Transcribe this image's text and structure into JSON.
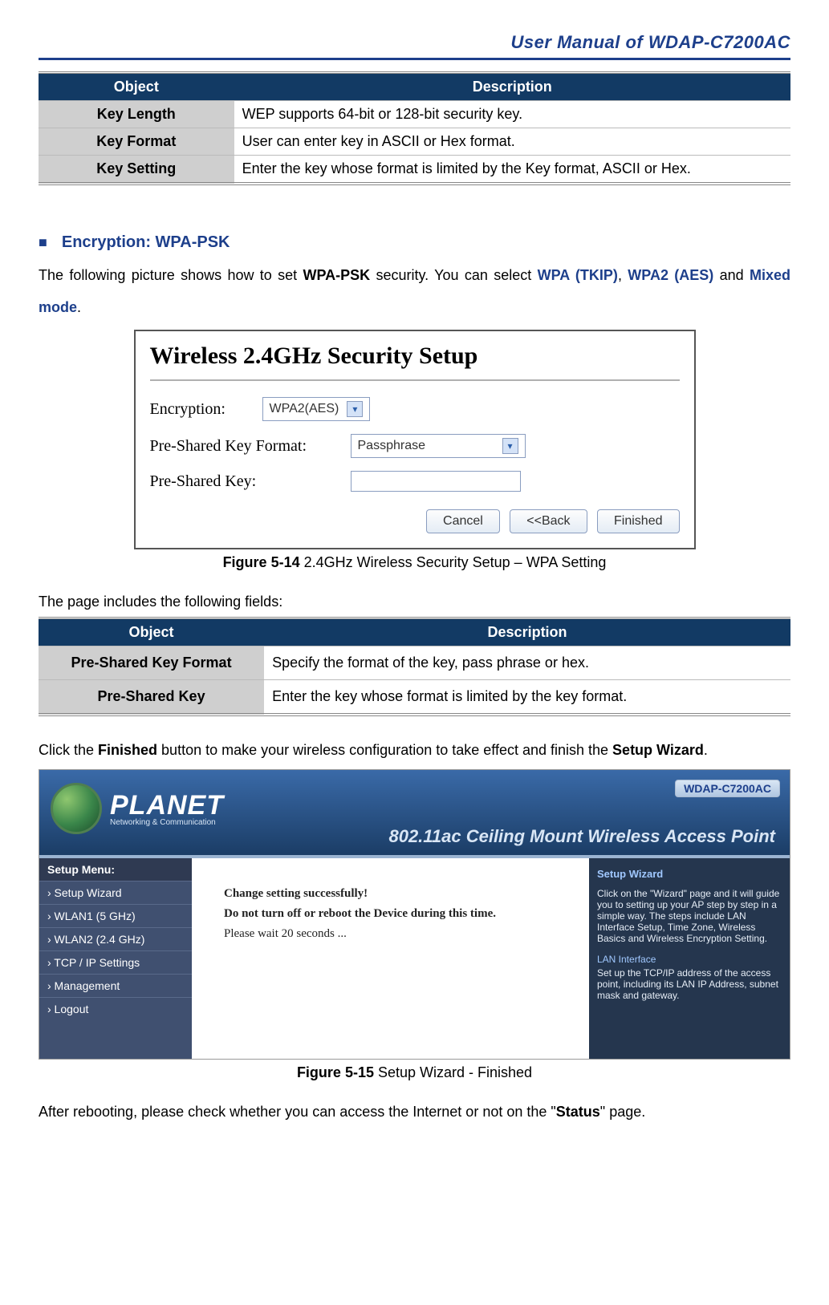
{
  "header": {
    "title": "User Manual of WDAP-C7200AC"
  },
  "table1": {
    "head_object": "Object",
    "head_desc": "Description",
    "rows": [
      {
        "obj": "Key Length",
        "desc": "WEP supports 64-bit or 128-bit security key."
      },
      {
        "obj": "Key Format",
        "desc": "User can enter key in ASCII or Hex format."
      },
      {
        "obj": "Key Setting",
        "desc": "Enter the key whose format is limited by the Key format, ASCII or Hex."
      }
    ]
  },
  "section1": {
    "title": "Encryption: WPA-PSK",
    "para_pre": "The following picture shows how to set ",
    "para_b1": "WPA-PSK",
    "para_mid": " security. You can select ",
    "hl1": "WPA (TKIP)",
    "sep1": ", ",
    "hl2": "WPA2 (AES)",
    "sep2": " and ",
    "hl3": "Mixed mode",
    "tail": "."
  },
  "fig514": {
    "big_title": "Wireless 2.4GHz Security Setup",
    "row_enc_label": "Encryption:",
    "row_enc_value": "WPA2(AES)",
    "row_pskf_label": "Pre-Shared Key Format:",
    "row_pskf_value": "Passphrase",
    "row_psk_label": "Pre-Shared Key:",
    "btn_cancel": "Cancel",
    "btn_back": "<<Back",
    "btn_finish": "Finished",
    "caption_b": "Figure 5-14",
    "caption_rest": " 2.4GHz Wireless Security Setup – WPA Setting"
  },
  "fields_intro": "The page includes the following fields:",
  "table2": {
    "head_object": "Object",
    "head_desc": "Description",
    "rows": [
      {
        "obj": "Pre-Shared Key Format",
        "desc": "Specify the format of the key, pass phrase or hex."
      },
      {
        "obj": "Pre-Shared Key",
        "desc": "Enter the key whose format is limited by the key format."
      }
    ]
  },
  "finish_line": {
    "pre": "Click the ",
    "b1": "Finished",
    "mid": " button to make your wireless configuration to take effect and finish the ",
    "b2": "Setup Wizard",
    "tail": "."
  },
  "fig515": {
    "badge": "WDAP-C7200AC",
    "banner": "802.11ac Ceiling Mount Wireless Access Point",
    "logo_main": "PLANET",
    "logo_sub": "Networking & Communication",
    "side_title": "Setup Menu:",
    "side_items": [
      "›  Setup Wizard",
      "›  WLAN1 (5 GHz)",
      "›  WLAN2 (2.4 GHz)",
      "›  TCP / IP  Settings",
      "›  Management",
      "›  Logout"
    ],
    "main_lines": [
      "Change setting successfully!",
      "Do not turn off or reboot the Device during this time.",
      "Please wait 20 seconds ..."
    ],
    "right_title": "Setup Wizard",
    "right_para": "Click on the \"Wizard\" page and it will guide you to setting up your AP step by step in a simple way. The steps include LAN Interface Setup, Time Zone, Wireless Basics and Wireless Encryption Setting.",
    "right_sub_title": "LAN Interface",
    "right_sub_para": "Set up the TCP/IP address of the access point, including its LAN IP Address, subnet mask and gateway.",
    "caption_b": "Figure 5-15",
    "caption_rest": " Setup Wizard - Finished"
  },
  "after_reboot": {
    "pre": "After rebooting, please check whether you can access the Internet or not on the \"",
    "b": "Status",
    "tail": "\" page."
  }
}
